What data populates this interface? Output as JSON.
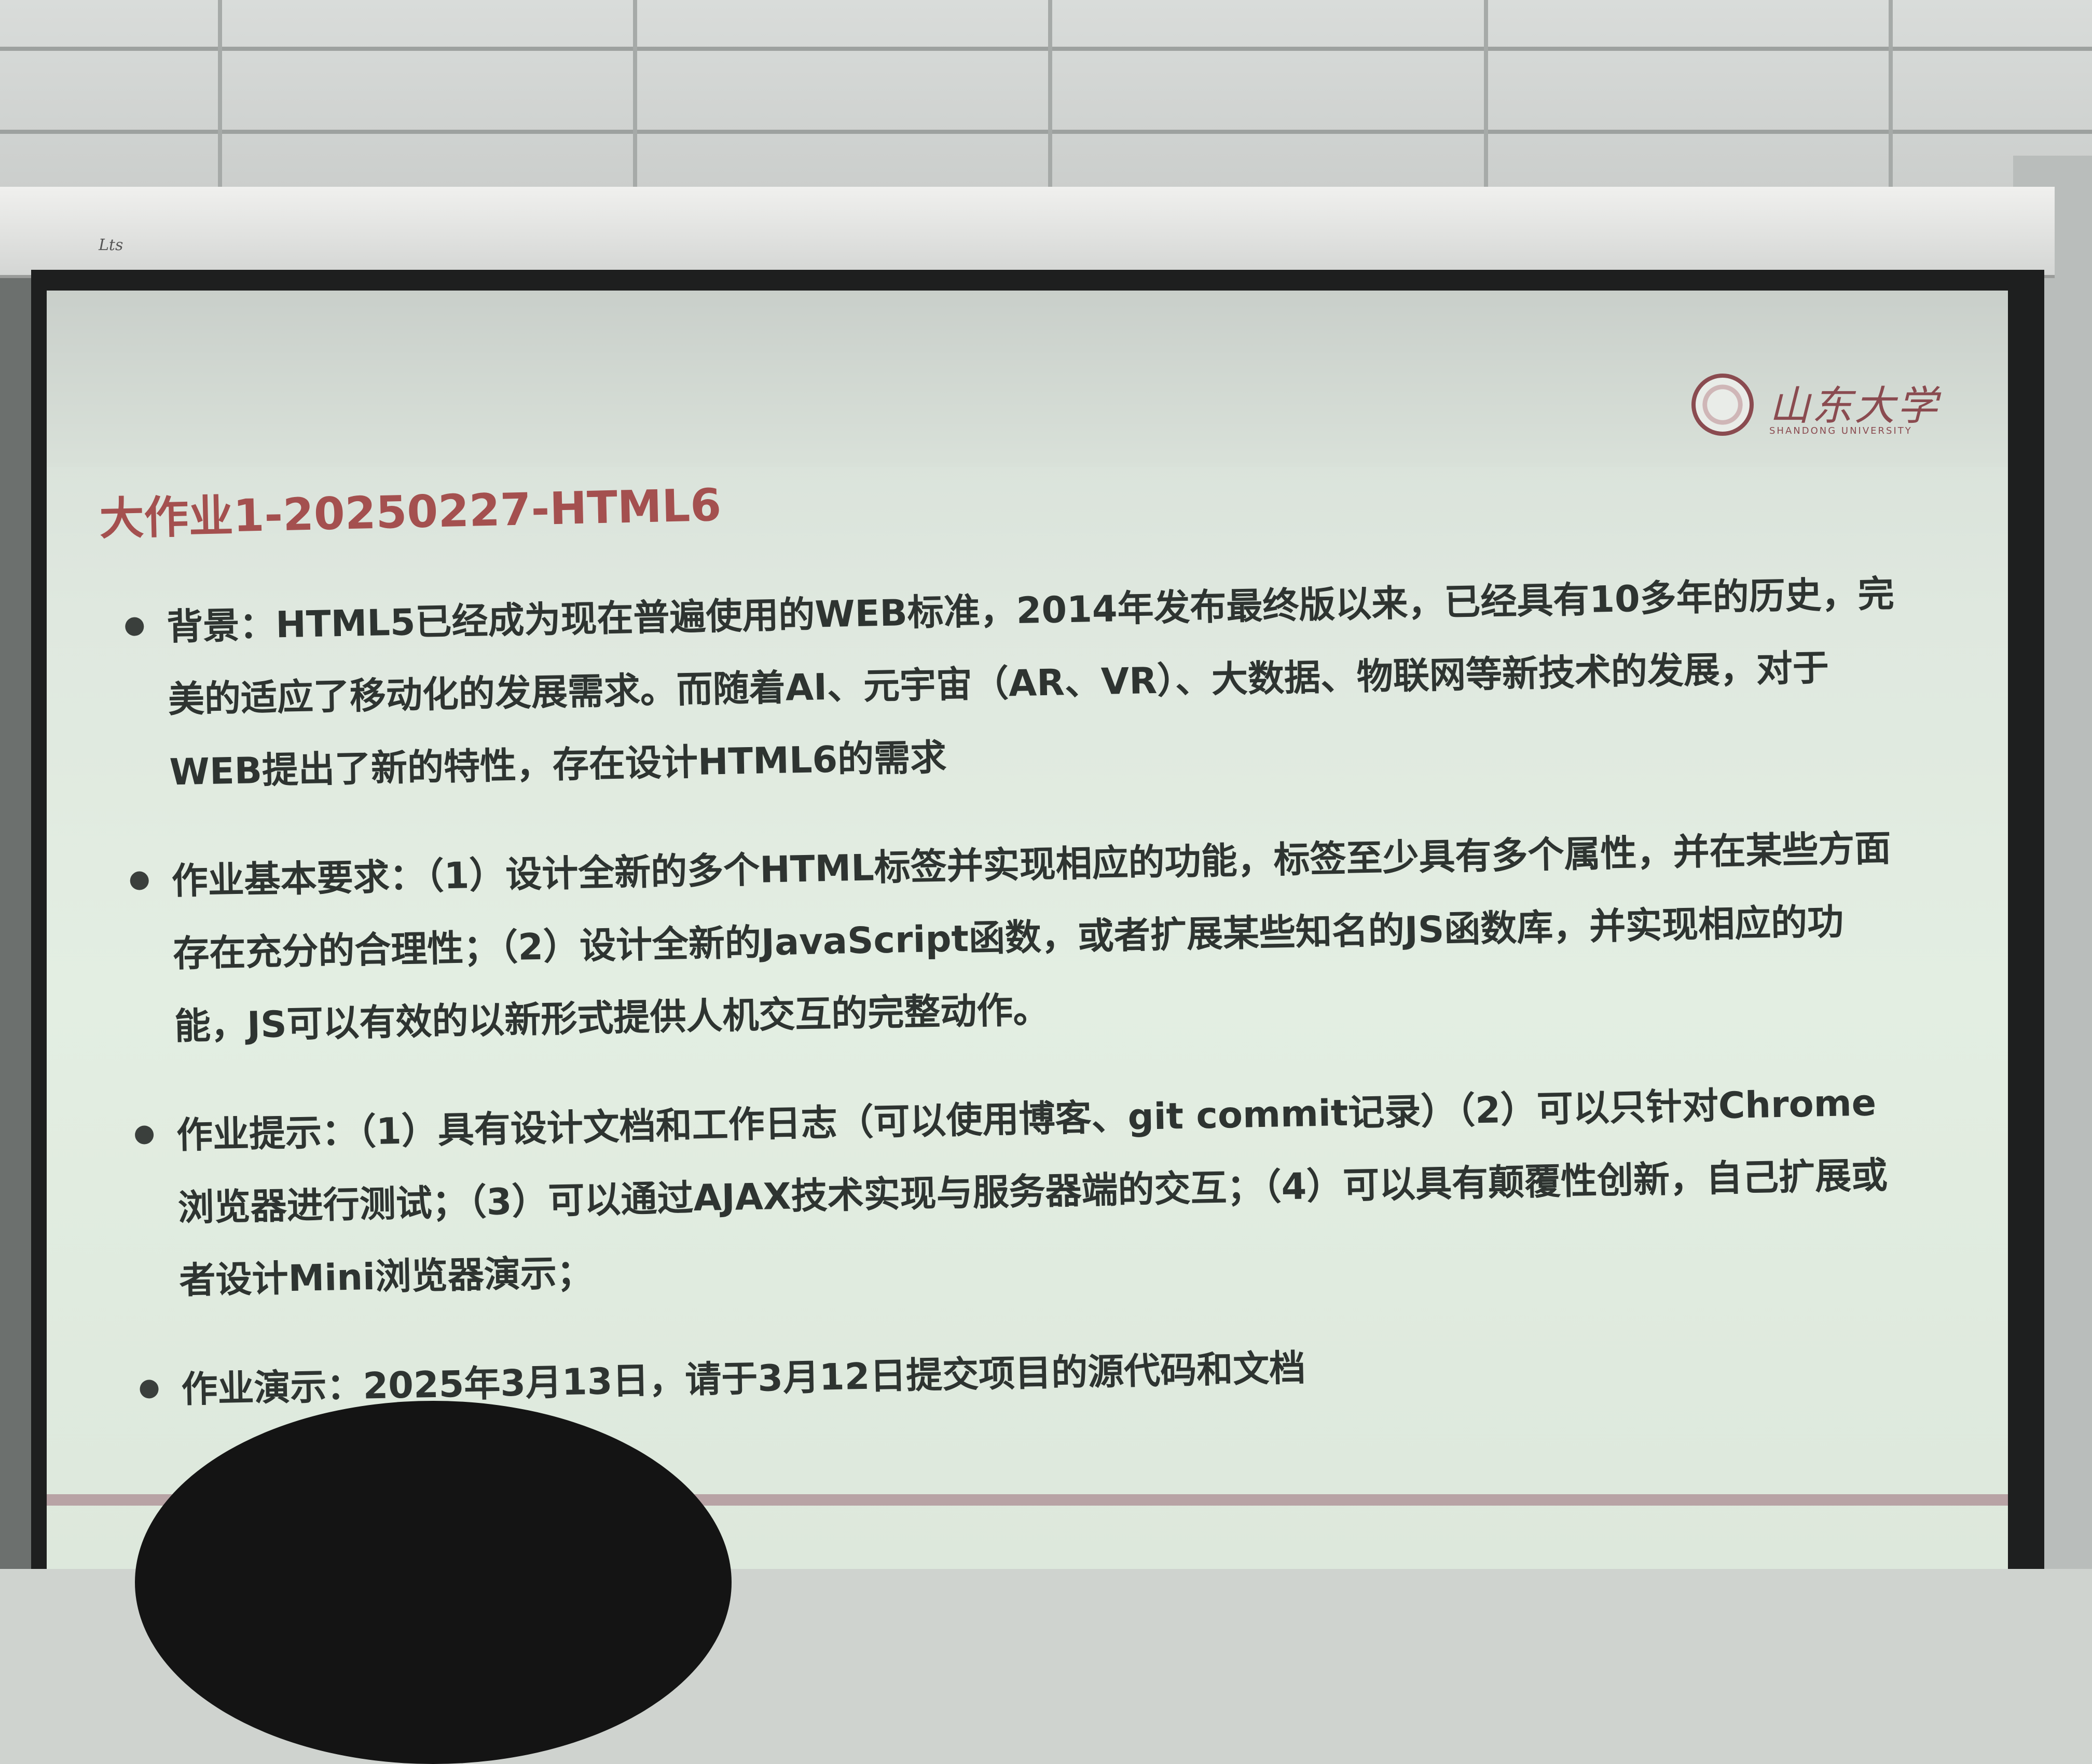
{
  "slide": {
    "title": "大作业1-20250227-HTML6",
    "logo_text": "山东大学",
    "logo_subtext": "SHANDONG UNIVERSITY",
    "bullets": [
      {
        "text": "背景：HTML5已经成为现在普遍使用的WEB标准，2014年发布最终版以来，已经具有10多年的历史，完美的适应了移动化的发展需求。而随着AI、元宇宙（AR、VR）、大数据、物联网等新技术的发展，对于WEB提出了新的特性，存在设计HTML6的需求"
      },
      {
        "text": "作业基本要求：（1）设计全新的多个HTML标签并实现相应的功能，标签至少具有多个属性，并在某些方面存在充分的合理性；（2）设计全新的JavaScript函数，或者扩展某些知名的JS函数库，并实现相应的功能，JS可以有效的以新形式提供人机交互的完整动作。"
      },
      {
        "text": "作业提示：（1）具有设计文档和工作日志（可以使用博客、git commit记录）（2）可以只针对Chrome浏览器进行测试；（3）可以通过AJAX技术实现与服务器端的交互；（4）可以具有颠覆性创新，自己扩展或者设计Mini浏览器演示；"
      },
      {
        "text": "作业演示：2025年3月13日，请于3月12日提交项目的源代码和文档"
      }
    ]
  },
  "screen_case": {
    "brand": "Lts"
  },
  "colors": {
    "title": "#a4504f",
    "body_text": "#2e3431",
    "slide_bg": "#e3eee2",
    "logo": "#8a4b50"
  }
}
